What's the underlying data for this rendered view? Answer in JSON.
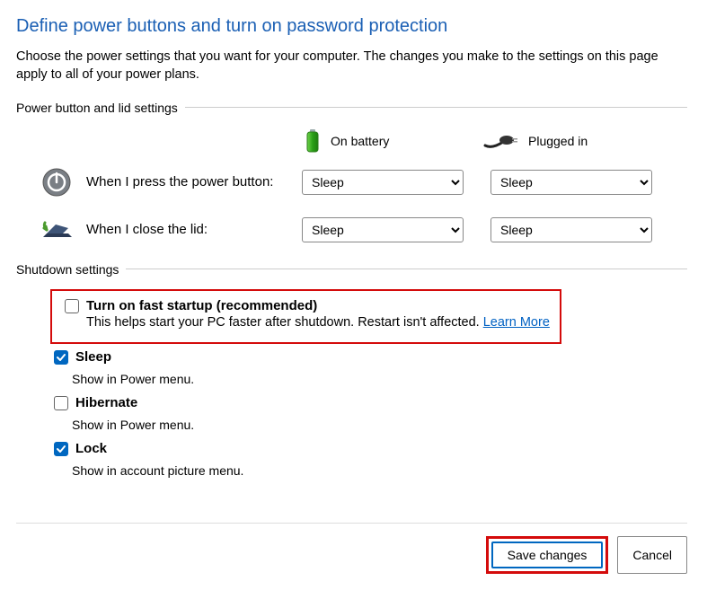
{
  "title": "Define power buttons and turn on password protection",
  "subtitle": "Choose the power settings that you want for your computer. The changes you make to the settings on this page apply to all of your power plans.",
  "sections": {
    "power_button": {
      "header": "Power button and lid settings",
      "col_battery": "On battery",
      "col_plugged": "Plugged in",
      "rows": {
        "power_btn": {
          "label": "When I press the power button:",
          "battery": "Sleep",
          "plugged": "Sleep"
        },
        "lid": {
          "label": "When I close the lid:",
          "battery": "Sleep",
          "plugged": "Sleep"
        }
      }
    },
    "shutdown": {
      "header": "Shutdown settings",
      "fast_startup": {
        "label": "Turn on fast startup (recommended)",
        "desc": "This helps start your PC faster after shutdown. Restart isn't affected. ",
        "link": "Learn More",
        "checked": false
      },
      "sleep": {
        "label": "Sleep",
        "desc": "Show in Power menu.",
        "checked": true
      },
      "hibernate": {
        "label": "Hibernate",
        "desc": "Show in Power menu.",
        "checked": false
      },
      "lock": {
        "label": "Lock",
        "desc": "Show in account picture menu.",
        "checked": true
      }
    }
  },
  "buttons": {
    "save": "Save changes",
    "cancel": "Cancel"
  },
  "options": {
    "sleep": "Sleep"
  }
}
